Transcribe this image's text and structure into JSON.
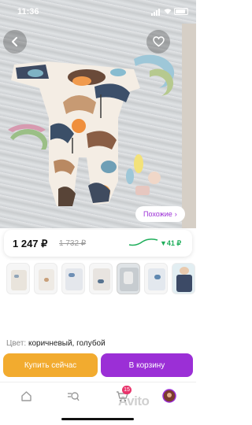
{
  "status_bar": {
    "time": "11:36"
  },
  "product": {
    "more_chip": "Похожие",
    "more_chip_arrow": "›",
    "price_current": "1 247 ₽",
    "price_old": "1 732 ₽",
    "price_delta": "▼41 ₽",
    "color_label": "Цвет:",
    "color_value": "коричневый, голубой"
  },
  "actions": {
    "buy_now": "Купить сейчас",
    "add_to_cart": "В корзину"
  },
  "tabbar": {
    "cart_badge": "15",
    "watermark": "Avito"
  },
  "colors": {
    "accent_purple": "#9b2fd6",
    "buy_orange": "#f2ab2f",
    "price_drop_green": "#1fae5b",
    "badge_pink": "#e8336b"
  },
  "icons": [
    "back-arrow-icon",
    "heart-icon",
    "home-icon",
    "search-icon",
    "cart-icon",
    "profile-avatar-icon"
  ]
}
